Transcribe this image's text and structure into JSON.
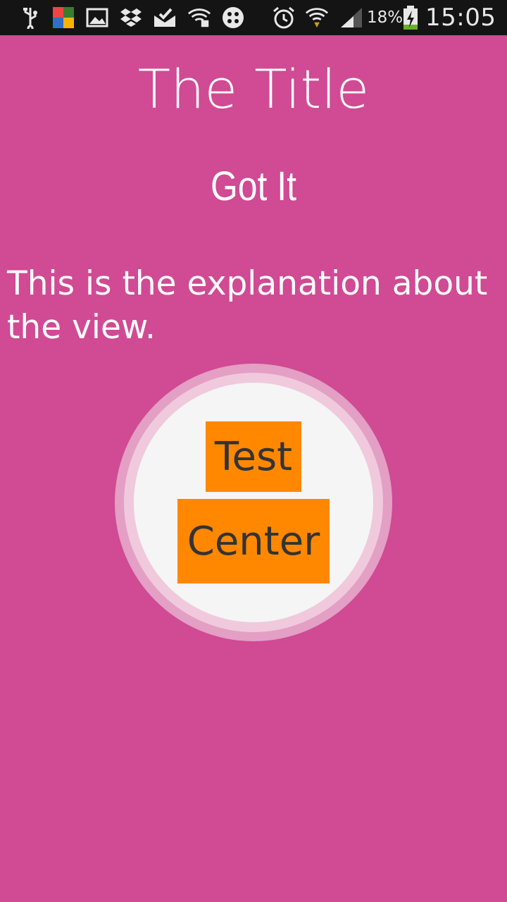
{
  "status_bar": {
    "icons": [
      "usb-icon",
      "avg-antivirus-icon",
      "gallery-icon",
      "dropbox-icon",
      "mail-check-icon",
      "wifi-lock-icon",
      "app-dots-icon",
      "alarm-icon",
      "wifi-icon",
      "signal-icon",
      "battery-charging-icon"
    ],
    "battery_percent": "18%",
    "time": "15:05"
  },
  "screen": {
    "title": "The Title",
    "subtitle": "Got It",
    "explanation": "This is the explanation about the view.",
    "spotlight": {
      "labels": [
        "Test",
        "Center"
      ],
      "label_color": "#333333",
      "label_background": "#ff8800"
    },
    "background_color": "#d04a94"
  }
}
